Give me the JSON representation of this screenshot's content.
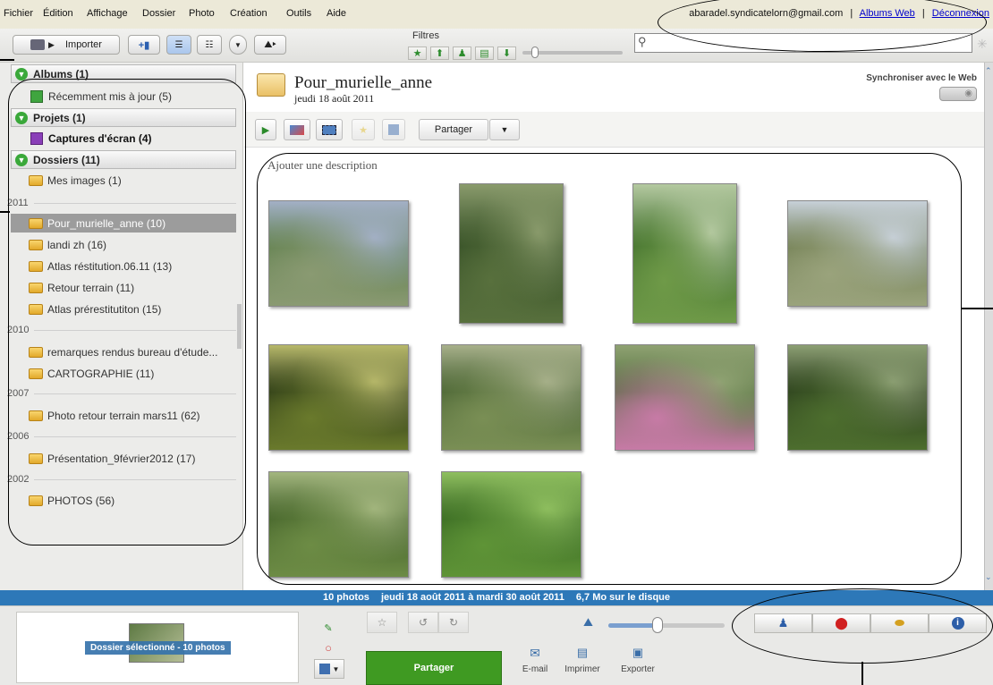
{
  "menu": [
    "Fichier",
    "Édition",
    "Affichage",
    "Dossier",
    "Photo",
    "Création",
    "Outils",
    "Aide"
  ],
  "account": {
    "email": "abaradel.syndicatelorn@gmail.com",
    "web_albums": "Albums Web",
    "logout": "Déconnexion",
    "separator": "|"
  },
  "toolbar": {
    "import_label": "Importer",
    "filters_label": "Filtres",
    "search_placeholder": ""
  },
  "sidebar": {
    "albums": {
      "label": "Albums (1)",
      "items": [
        "Récemment mis à jour (5)"
      ]
    },
    "projects": {
      "label": "Projets (1)",
      "items": [
        "Captures d'écran (4)"
      ]
    },
    "folders": {
      "label": "Dossiers (11)",
      "top_items": [
        "Mes images (1)"
      ],
      "groups": [
        {
          "year": "2011",
          "items": [
            "Pour_murielle_anne (10)",
            "landi zh (16)",
            "Atlas réstitution.06.11 (13)",
            "Retour terrain (11)",
            "Atlas prérestitutiton (15)"
          ]
        },
        {
          "year": "2010",
          "items": [
            "remarques rendus bureau d'étude...",
            "CARTOGRAPHIE (11)"
          ]
        },
        {
          "year": "2007",
          "items": [
            "Photo retour terrain mars11 (62)"
          ]
        },
        {
          "year": "2006",
          "items": [
            "Présentation_9février2012 (17)"
          ]
        },
        {
          "year": "2002",
          "items": [
            "PHOTOS (56)"
          ]
        }
      ]
    },
    "selected": "Pour_murielle_anne (10)"
  },
  "main": {
    "folder_title": "Pour_murielle_anne",
    "folder_date": "jeudi 18 août 2011",
    "sync_label": "Synchroniser avec le Web",
    "share_label": "Partager",
    "description_placeholder": "Ajouter une description",
    "photos": [
      {
        "palette": [
          "#5b7d4a",
          "#8a9a72",
          "#a3b0c6"
        ]
      },
      {
        "palette": [
          "#2f4a22",
          "#58703d",
          "#8a9b6c"
        ]
      },
      {
        "palette": [
          "#3b6a2a",
          "#6f9a48",
          "#b4c9a0"
        ]
      },
      {
        "palette": [
          "#6c7a4e",
          "#9aa37c",
          "#c7d0d8"
        ]
      },
      {
        "palette": [
          "#1e2c12",
          "#6a7a2c",
          "#b7b86a"
        ]
      },
      {
        "palette": [
          "#3e5a2c",
          "#7a8f55",
          "#a7b08a"
        ]
      },
      {
        "palette": [
          "#4e6b3a",
          "#c77aa6",
          "#8fa272"
        ]
      },
      {
        "palette": [
          "#25361a",
          "#4d6e2e",
          "#8c9f73"
        ]
      },
      {
        "palette": [
          "#3b5a25",
          "#6d8c45",
          "#a3b67e"
        ]
      },
      {
        "palette": [
          "#2f5f1e",
          "#5f9437",
          "#8fbf5f"
        ]
      }
    ]
  },
  "status": {
    "photo_count": "10 photos",
    "date_range": "jeudi 18 août 2011 à mardi 30 août 2011",
    "disk_size": "6,7 Mo sur le disque"
  },
  "tray": {
    "selection_label": "Dossier sélectionné - 10 photos",
    "share_button": "Partager",
    "email_label": "E-mail",
    "print_label": "Imprimer",
    "export_label": "Exporter",
    "zoom_level": 0.42
  },
  "colors": {
    "accent_blue": "#2d78b8",
    "share_green": "#3f9a22",
    "selected_folder": "#9c9c9c"
  }
}
